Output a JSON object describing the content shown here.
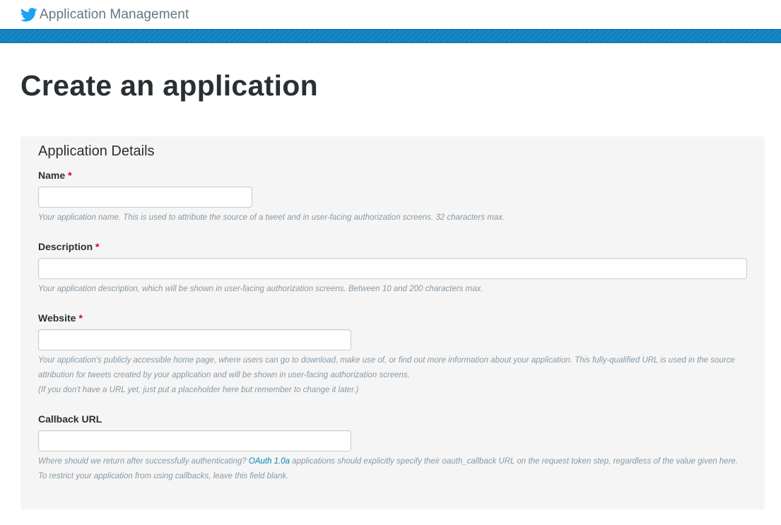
{
  "header": {
    "brand_title": "Application Management",
    "logo_icon": "twitter-bird-icon",
    "brand_color": "#1da1f2",
    "bar_color": "#0f7fc0"
  },
  "page": {
    "title": "Create an application"
  },
  "form": {
    "section_title": "Application Details",
    "required_marker": "*",
    "fields": [
      {
        "label": "Name",
        "required": true,
        "value": "",
        "help": "Your application name. This is used to attribute the source of a tweet and in user-facing authorization screens. 32 characters max."
      },
      {
        "label": "Description",
        "required": true,
        "value": "",
        "help": "Your application description, which will be shown in user-facing authorization screens. Between 10 and 200 characters max."
      },
      {
        "label": "Website",
        "required": true,
        "value": "",
        "help_line1": "Your application's publicly accessible home page, where users can go to download, make use of, or find out more information about your application. This fully-qualified URL is used in the source attribution for tweets created by your application and will be shown in user-facing authorization screens.",
        "help_line2": "(If you don't have a URL yet, just put a placeholder here but remember to change it later.)"
      },
      {
        "label": "Callback URL",
        "required": false,
        "value": "",
        "help_before": "Where should we return after successfully authenticating? ",
        "help_link": "OAuth 1.0a",
        "help_after": " applications should explicitly specify their oauth_callback URL on the request token step, regardless of the value given here. To restrict your application from using callbacks, leave this field blank."
      }
    ]
  }
}
